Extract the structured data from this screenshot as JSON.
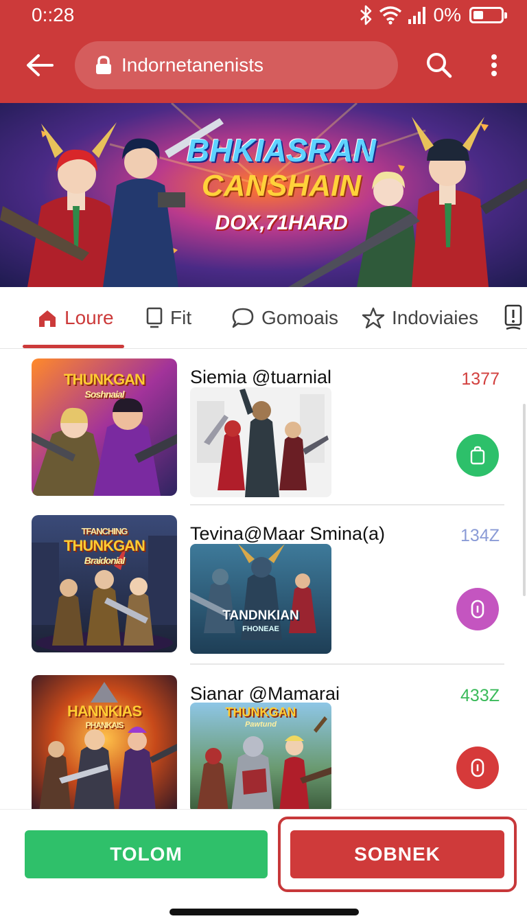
{
  "status_bar": {
    "time": "0::28",
    "battery": "0%"
  },
  "app_bar": {
    "url": "Indornetanenists"
  },
  "banner": {
    "line1": "BHKIASRAN",
    "line2": "CANSHAIN",
    "line3": "DOX,71HARD"
  },
  "tabs": [
    {
      "label": "Loure",
      "icon": "home-icon",
      "active": true
    },
    {
      "label": "Fit",
      "icon": "monitor-icon"
    },
    {
      "label": "Gomoais",
      "icon": "chat-bubble-icon"
    },
    {
      "label": "Indoviaies",
      "icon": "star-icon"
    }
  ],
  "items": [
    {
      "title": "Siemia @tuarnial",
      "count": "1377",
      "count_color": "#d2403e",
      "thumb_title": "THUNKGAN",
      "thumb_sub": "Soshnaial",
      "preview_label": "",
      "action_color": "#2dc06a",
      "action_icon": "bag-icon"
    },
    {
      "title": "Tevina@Maar Smina(a)",
      "count": "134Z",
      "count_color": "#8a9bd6",
      "thumb_title": "THUNKGAN",
      "thumb_top": "TFANCHING",
      "thumb_sub": "Braidonial",
      "preview_label": "TANDNKIAN",
      "preview_sub": "FHONEAE",
      "action_color": "#c455c0",
      "action_icon": "capsule-icon"
    },
    {
      "title": "Sianar @Mamarai",
      "count": "433Z",
      "count_color": "#3aba5a",
      "thumb_title": "HANNKIAS",
      "thumb_sub": "PHANKAIS",
      "preview_label": "THUNKGAN",
      "preview_sub": "Pawtund",
      "action_color": "#d63a3a",
      "action_icon": "capsule-icon"
    }
  ],
  "bottom": {
    "left_button": "TOLOM",
    "right_button": "SOBNEK"
  },
  "colors": {
    "primary": "#cc3a3a",
    "green": "#2fc06a"
  }
}
